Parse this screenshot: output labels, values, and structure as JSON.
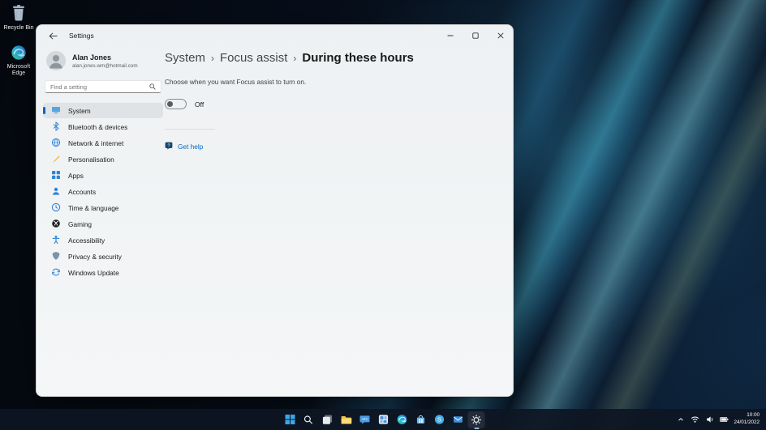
{
  "desktop": {
    "icons": [
      {
        "label": "Recycle Bin",
        "icon": "recycle-bin-icon"
      },
      {
        "label": "Microsoft Edge",
        "icon": "edge-icon"
      }
    ]
  },
  "settings_window": {
    "titlebar": {
      "title": "Settings",
      "controls": [
        "minimize",
        "maximize",
        "close"
      ]
    },
    "profile": {
      "name": "Alan Jones",
      "email": "alan.jones.wm@hotmail.com"
    },
    "search": {
      "placeholder": "Find a setting"
    },
    "nav": {
      "items": [
        {
          "label": "System",
          "icon": "system-icon",
          "selected": true
        },
        {
          "label": "Bluetooth & devices",
          "icon": "bluetooth-icon"
        },
        {
          "label": "Network & internet",
          "icon": "globe-icon"
        },
        {
          "label": "Personalisation",
          "icon": "brush-icon"
        },
        {
          "label": "Apps",
          "icon": "apps-grid-icon"
        },
        {
          "label": "Accounts",
          "icon": "person-icon"
        },
        {
          "label": "Time & language",
          "icon": "clock-icon"
        },
        {
          "label": "Gaming",
          "icon": "xbox-icon"
        },
        {
          "label": "Accessibility",
          "icon": "accessibility-icon"
        },
        {
          "label": "Privacy & security",
          "icon": "shield-icon"
        },
        {
          "label": "Windows Update",
          "icon": "update-icon"
        }
      ]
    },
    "content": {
      "breadcrumb": {
        "items": [
          {
            "label": "System"
          },
          {
            "label": "Focus assist"
          },
          {
            "label": "During these hours"
          }
        ],
        "separator": "›"
      },
      "description": "Choose when you want Focus assist to turn on.",
      "toggle": {
        "label": "Off",
        "state": "off"
      },
      "help_link": {
        "label": "Get help",
        "icon": "get-help-icon"
      }
    }
  },
  "taskbar": {
    "pinned": [
      "start",
      "search",
      "task-view",
      "file-explorer",
      "chat",
      "widgets",
      "edge",
      "store",
      "skype",
      "mail",
      "settings"
    ],
    "active_app": "settings",
    "tray": {
      "icons": [
        "chevron-up",
        "wifi",
        "volume",
        "battery"
      ],
      "time": "10:00",
      "date": "24/01/2022"
    }
  }
}
